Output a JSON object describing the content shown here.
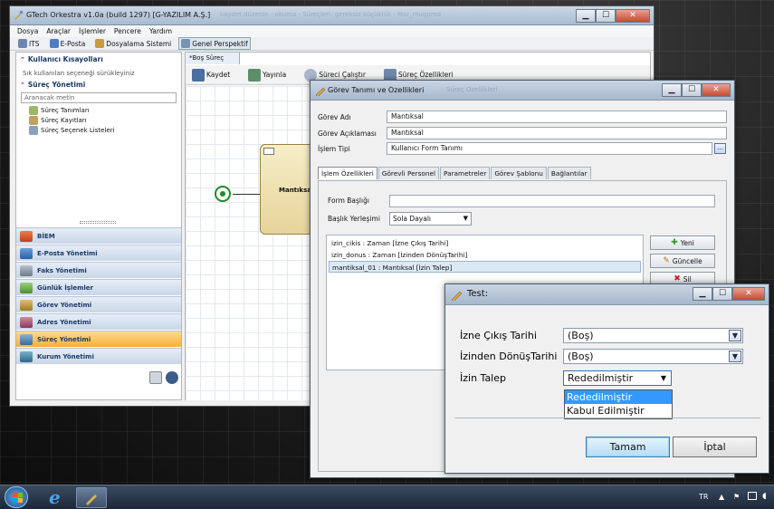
{
  "main_window": {
    "title": "GTech Orkestra v1.0a (build 1297) [G-YAZILIM A.Ş.]",
    "title_overlay": "kaydet düzenle - okuma - Süreçleri: gereksiz küçüklük - Mar_mugpmd",
    "menu": [
      "Dosya",
      "Araçlar",
      "İşlemler",
      "Pencere",
      "Yardım"
    ],
    "toolbar": [
      "ITS",
      "E-Posta",
      "Dosyalama Sistemi",
      "Genel Perspektif"
    ]
  },
  "left_panel": {
    "shortcuts_title": "Kullanıcı Kısayolları",
    "shortcuts_hint": "Sık kullanılan seçeneği sürükleyiniz",
    "process_title": "Süreç Yönetimi",
    "search_placeholder": "Aranacak metin",
    "tree_items": [
      "Süreç Tanımları",
      "Süreç Kayıtları",
      "Süreç Seçenek Listeleri"
    ],
    "nav_buttons": [
      "BİEM",
      "E-Posta Yönetimi",
      "Faks Yönetimi",
      "Günlük İşlemler",
      "Görev Yönetimi",
      "Adres Yönetimi",
      "Süreç Yönetimi",
      "Kurum Yönetimi"
    ],
    "selected_nav": "Süreç Yönetimi"
  },
  "editor": {
    "tab_label": "*Boş Süreç",
    "toolbar": [
      "Kaydet",
      "Yayınla",
      "Süreci Çalıştır",
      "Süreç Özellikleri"
    ],
    "task_node_label": "Mantıksal"
  },
  "task_dialog": {
    "title": "Görev Tanımı ve Özellikleri",
    "ghost_title": "Süreç Özellikleri",
    "fields": [
      {
        "label": "Görev Adı",
        "value": "Mantıksal"
      },
      {
        "label": "Görev Açıklaması",
        "value": "Mantıksal"
      },
      {
        "label": "İşlem Tipi",
        "value": "Kullanıcı Form Tanımı"
      }
    ],
    "browse_label": "...",
    "tabs": [
      "İşlem Özellikleri",
      "Görevli Personel",
      "Parametreler",
      "Görev Şablonu",
      "Bağlantılar"
    ],
    "form_title_label": "Form Başlığı",
    "form_title_value": "",
    "title_position_label": "Başlık Yerleşimi",
    "title_position_value": "Sola Dayalı",
    "list_items": [
      "izin_cikis : Zaman [İzne Çıkış Tarihi]",
      "izin_donus : Zaman [İzinden DönüşTarihi]",
      "mantiksal_01 : Mantıksal [İzin Talep]"
    ],
    "buttons": [
      "Yeni",
      "Güncelle",
      "Sil"
    ]
  },
  "test_dialog": {
    "title": "Test:",
    "rows": [
      {
        "label": "İzne Çıkış Tarihi",
        "value": "(Boş)"
      },
      {
        "label": "İzinden DönüşTarihi",
        "value": "(Boş)"
      },
      {
        "label": "İzin Talep",
        "value": "Rededilmiştir"
      }
    ],
    "dropdown_options": [
      "Rededilmiştir",
      "Kabul Edilmiştir"
    ],
    "ok_label": "Tamam",
    "cancel_label": "İptal"
  },
  "taskbar": {
    "language": "TR"
  },
  "colors": {
    "selection_blue": "#3399ff",
    "nav_selected": "#f2b23b",
    "title_bar": "#a9bbd2",
    "close_red": "#c64a33"
  }
}
